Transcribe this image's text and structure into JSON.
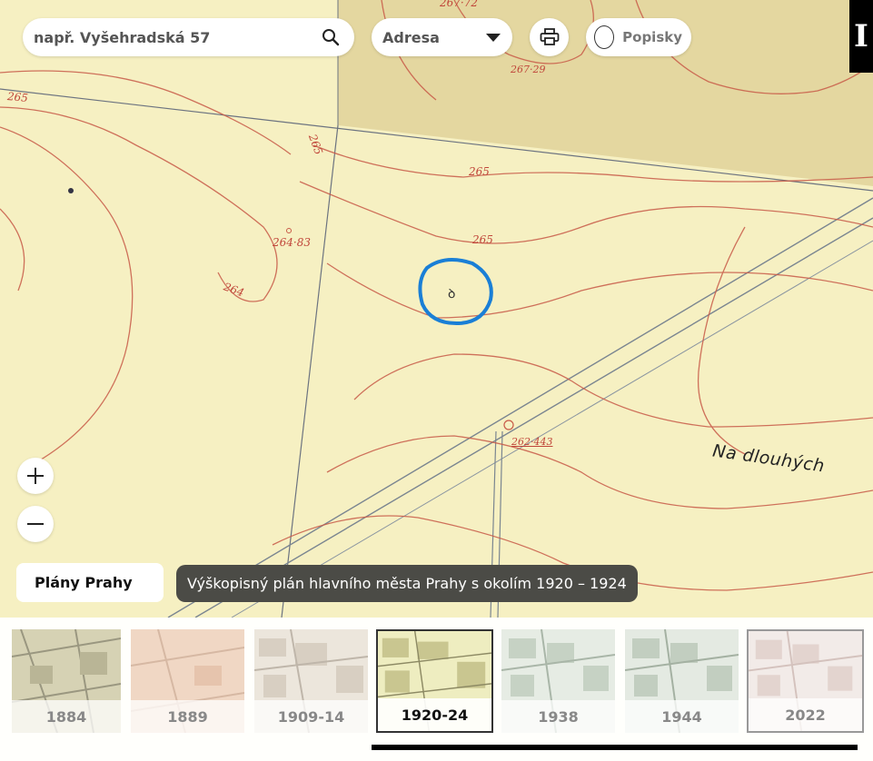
{
  "search": {
    "placeholder": "např. Vyšehradská 57"
  },
  "search_type": {
    "selected": "Adresa"
  },
  "labels_toggle": {
    "label": "Popisky"
  },
  "info_button": {
    "label": "I"
  },
  "map": {
    "place_name": "Na dlouhých",
    "elevations": [
      "267·72",
      "267·29",
      "265",
      "265",
      "265",
      "265",
      "264·83",
      "264",
      "262·443"
    ]
  },
  "plans_label": "Plány Prahy",
  "current_plan": "Výškopisný plán hlavního města Prahy s okolím 1920 – 1924",
  "timeline": [
    {
      "year": "1884"
    },
    {
      "year": "1889"
    },
    {
      "year": "1909-14"
    },
    {
      "year": "1920-24"
    },
    {
      "year": "1938"
    },
    {
      "year": "1944"
    },
    {
      "year": "2022"
    }
  ],
  "colors": {
    "marker": "#1a7fd6",
    "contour": "#c85a48",
    "map_paper": "#f6f0c2"
  }
}
